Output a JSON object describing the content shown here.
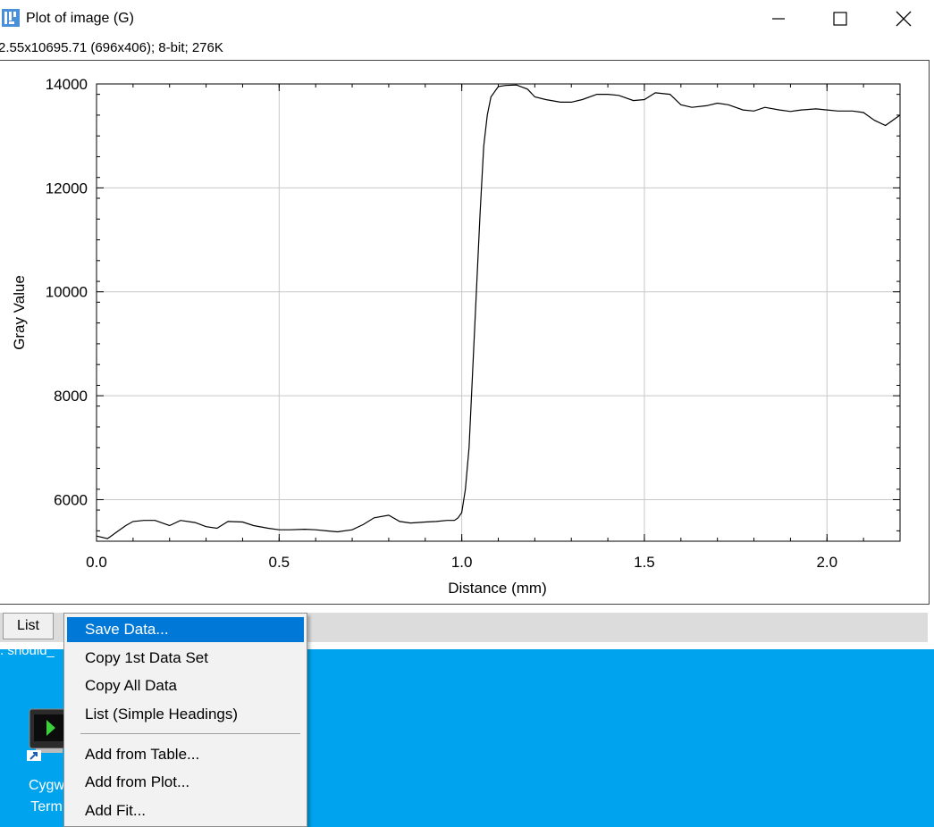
{
  "window": {
    "title": "Plot of image (G)",
    "status": "2.55x10695.71   (696x406); 8-bit; 276K",
    "icons": {
      "app": "imagej-icon",
      "minimize": "minimize-icon",
      "maximize": "maximize-icon",
      "close": "close-icon"
    }
  },
  "chart_data": {
    "type": "line",
    "xlabel": "Distance (mm)",
    "ylabel": "Gray Value",
    "xlim": [
      0,
      2.2
    ],
    "ylim": [
      5200,
      14000
    ],
    "grid": true,
    "x_ticks": [
      0.0,
      0.5,
      1.0,
      1.5,
      2.0
    ],
    "x_tick_labels": [
      "0.0",
      "0.5",
      "1.0",
      "1.5",
      "2.0"
    ],
    "y_ticks": [
      6000,
      8000,
      10000,
      12000,
      14000
    ],
    "y_tick_labels": [
      "6000",
      "8000",
      "10000",
      "12000",
      "14000"
    ],
    "series": [
      {
        "x": [
          0.0,
          0.03,
          0.05,
          0.08,
          0.1,
          0.13,
          0.16,
          0.2,
          0.23,
          0.27,
          0.3,
          0.33,
          0.36,
          0.4,
          0.43,
          0.47,
          0.5,
          0.53,
          0.57,
          0.6,
          0.63,
          0.66,
          0.7,
          0.73,
          0.76,
          0.8,
          0.83,
          0.86,
          0.9,
          0.93,
          0.96,
          0.98,
          0.99,
          1.0,
          1.01,
          1.02,
          1.03,
          1.04,
          1.05,
          1.06,
          1.07,
          1.08,
          1.1,
          1.12,
          1.15,
          1.18,
          1.2,
          1.23,
          1.27,
          1.3,
          1.33,
          1.37,
          1.4,
          1.43,
          1.47,
          1.5,
          1.53,
          1.57,
          1.6,
          1.63,
          1.67,
          1.7,
          1.73,
          1.77,
          1.8,
          1.83,
          1.87,
          1.9,
          1.93,
          1.97,
          2.0,
          2.03,
          2.07,
          2.1,
          2.13,
          2.16,
          2.2
        ],
        "y": [
          5300,
          5250,
          5350,
          5500,
          5580,
          5600,
          5600,
          5500,
          5600,
          5560,
          5480,
          5450,
          5580,
          5570,
          5500,
          5450,
          5420,
          5420,
          5430,
          5420,
          5400,
          5380,
          5420,
          5520,
          5650,
          5700,
          5580,
          5550,
          5570,
          5580,
          5600,
          5600,
          5650,
          5750,
          6200,
          7000,
          8500,
          10000,
          11500,
          12800,
          13400,
          13750,
          13950,
          13970,
          13980,
          13900,
          13750,
          13700,
          13650,
          13650,
          13700,
          13800,
          13800,
          13780,
          13680,
          13700,
          13830,
          13800,
          13600,
          13550,
          13580,
          13630,
          13600,
          13500,
          13480,
          13550,
          13500,
          13470,
          13500,
          13520,
          13500,
          13480,
          13480,
          13450,
          13300,
          13200,
          13400
        ]
      }
    ]
  },
  "toolbar": {
    "list_label": "List"
  },
  "desktop": {
    "fragment_text": ". should_",
    "icon": "cygwin-terminal-icon",
    "label_line1": "Cygw",
    "label_line2": "Term"
  },
  "menu": {
    "items": [
      {
        "label": "Save Data...",
        "selected": true
      },
      {
        "label": "Copy 1st Data Set"
      },
      {
        "label": "Copy All Data"
      },
      {
        "label": "List (Simple Headings)"
      },
      {
        "label": "Add from Table..."
      },
      {
        "label": "Add from Plot..."
      },
      {
        "label": "Add Fit..."
      }
    ]
  }
}
